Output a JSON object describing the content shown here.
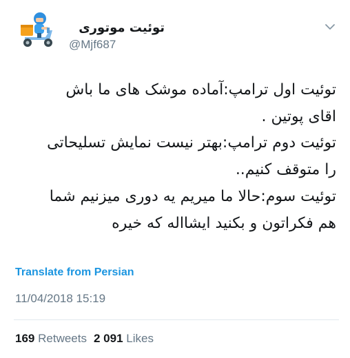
{
  "tweet": {
    "display_name": "توئیت موتوری",
    "handle": "@Mjf687",
    "avatar_icon": "scooter-delivery-avatar",
    "menu_icon": "chevron-down-icon",
    "lines": [
      "توئیت اول ترامپ:آماده موشک های ما باش",
      "اقای پوتین .",
      "توئیت دوم ترامپ:بهتر نیست نمایش تسلیحاتی",
      "را متوقف کنیم..",
      "توئیت سوم:حالا ما میریم یه دوری میزنیم شما",
      "هم فکراتون و بکنید ایشااله که خیره"
    ],
    "translate_label": "Translate from Persian",
    "timestamp": "11/04/2018 15:19"
  },
  "stats": {
    "retweets_count": "169",
    "retweets_label": "Retweets",
    "likes_count": "2 091",
    "likes_label": "Likes"
  },
  "colors": {
    "link": "#1b95e0",
    "muted": "#657786",
    "text": "#14171a",
    "divider": "#e1e8ed",
    "avatar_bg": "#ffffff"
  }
}
